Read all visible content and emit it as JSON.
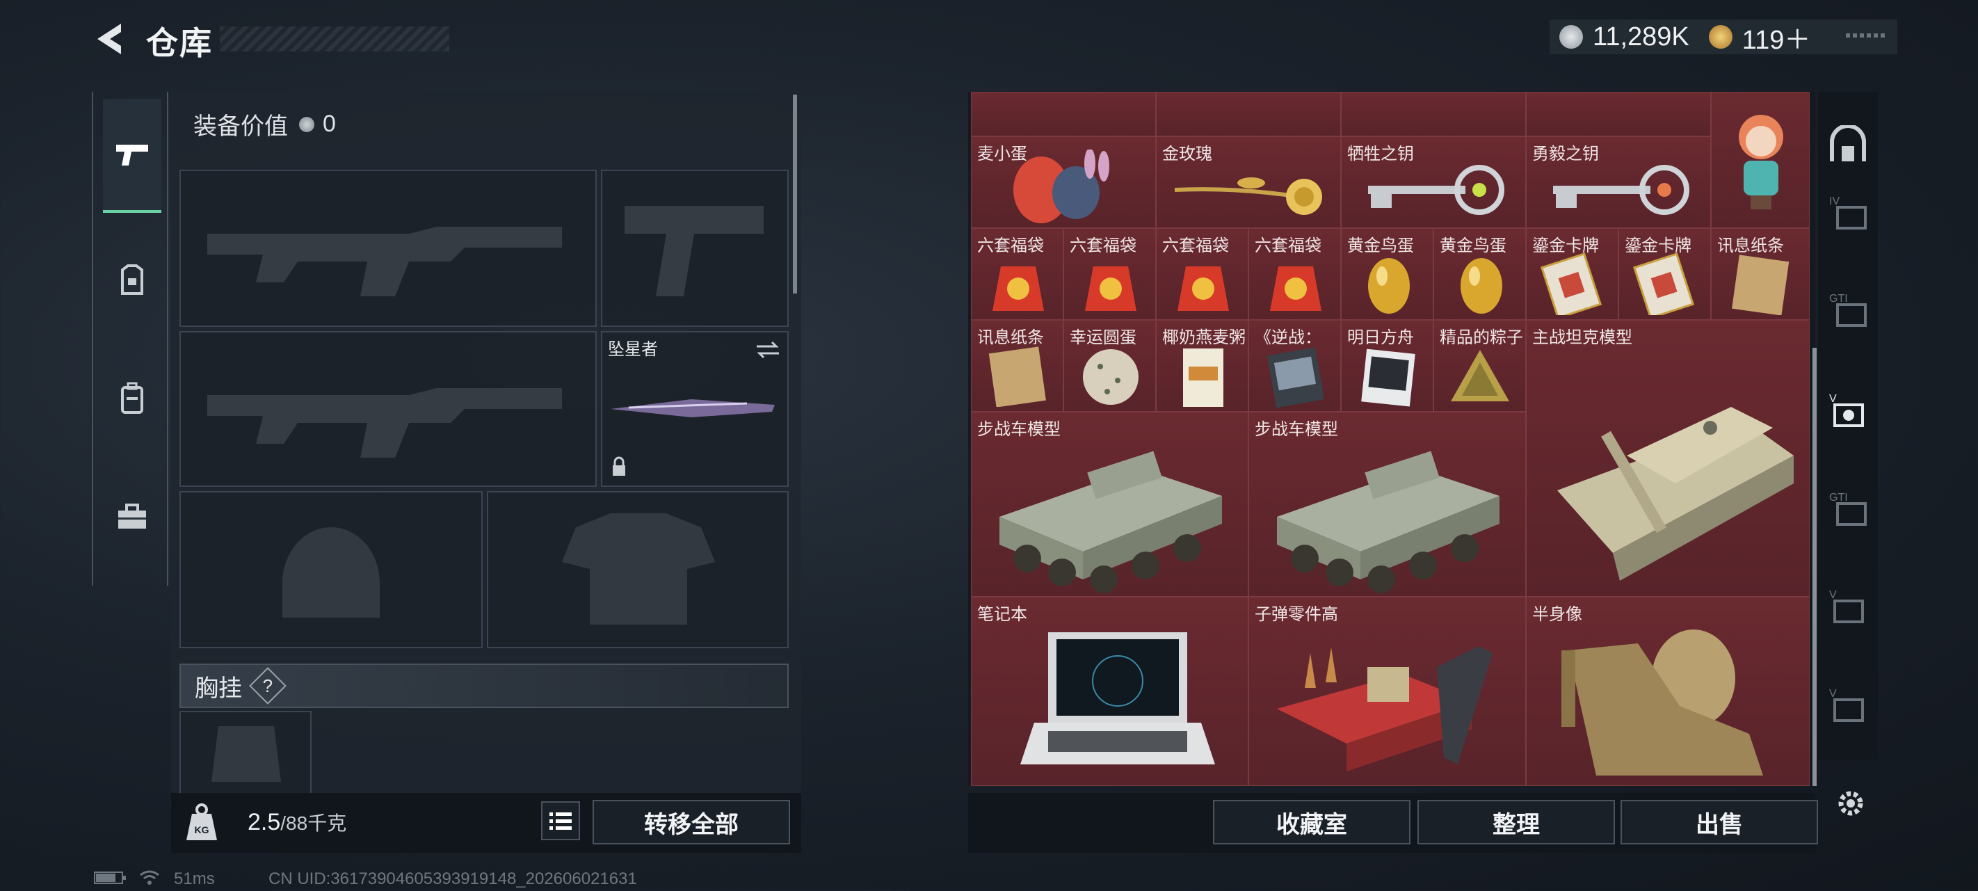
{
  "header": {
    "title": "仓库"
  },
  "currency": [
    {
      "value": "11,289K",
      "icon": "silver-coin-icon",
      "color": "#b8bfc6"
    },
    {
      "value": "119＋",
      "icon": "gold-coin-icon",
      "color": "#d9a441"
    }
  ],
  "loadout": {
    "equip_value_label": "装备价值",
    "equip_value": "0",
    "melee_name": "坠星者",
    "section_title": "胸挂",
    "section_help": "?"
  },
  "weight": {
    "value": "2.5",
    "unit": "/88千克"
  },
  "buttons": {
    "transfer_all": "转移全部",
    "collection": "收藏室",
    "sort": "整理",
    "sell": "出售"
  },
  "inventory_items": [
    {
      "label": "麦小蛋"
    },
    {
      "label": "金玫瑰"
    },
    {
      "label": "牺牲之钥"
    },
    {
      "label": "勇毅之钥"
    },
    {
      "label": "六套福袋"
    },
    {
      "label": "六套福袋"
    },
    {
      "label": "六套福袋"
    },
    {
      "label": "六套福袋"
    },
    {
      "label": "黄金鸟蛋"
    },
    {
      "label": "黄金鸟蛋"
    },
    {
      "label": "鎏金卡牌"
    },
    {
      "label": "鎏金卡牌"
    },
    {
      "label": "讯息纸条"
    },
    {
      "label": "讯息纸条"
    },
    {
      "label": "幸运圆蛋"
    },
    {
      "label": "椰奶燕麦粥"
    },
    {
      "label": "《逆战："
    },
    {
      "label": "明日方舟"
    },
    {
      "label": "精品的粽子"
    },
    {
      "label": "主战坦克模型"
    },
    {
      "label": "步战车模型"
    },
    {
      "label": "步战车模型"
    },
    {
      "label": "笔记本"
    },
    {
      "label": "子弹零件高"
    },
    {
      "label": "半身像"
    }
  ],
  "status": {
    "ping": "51ms",
    "uid": "CN UID:36173904605393919148_202606021631"
  }
}
